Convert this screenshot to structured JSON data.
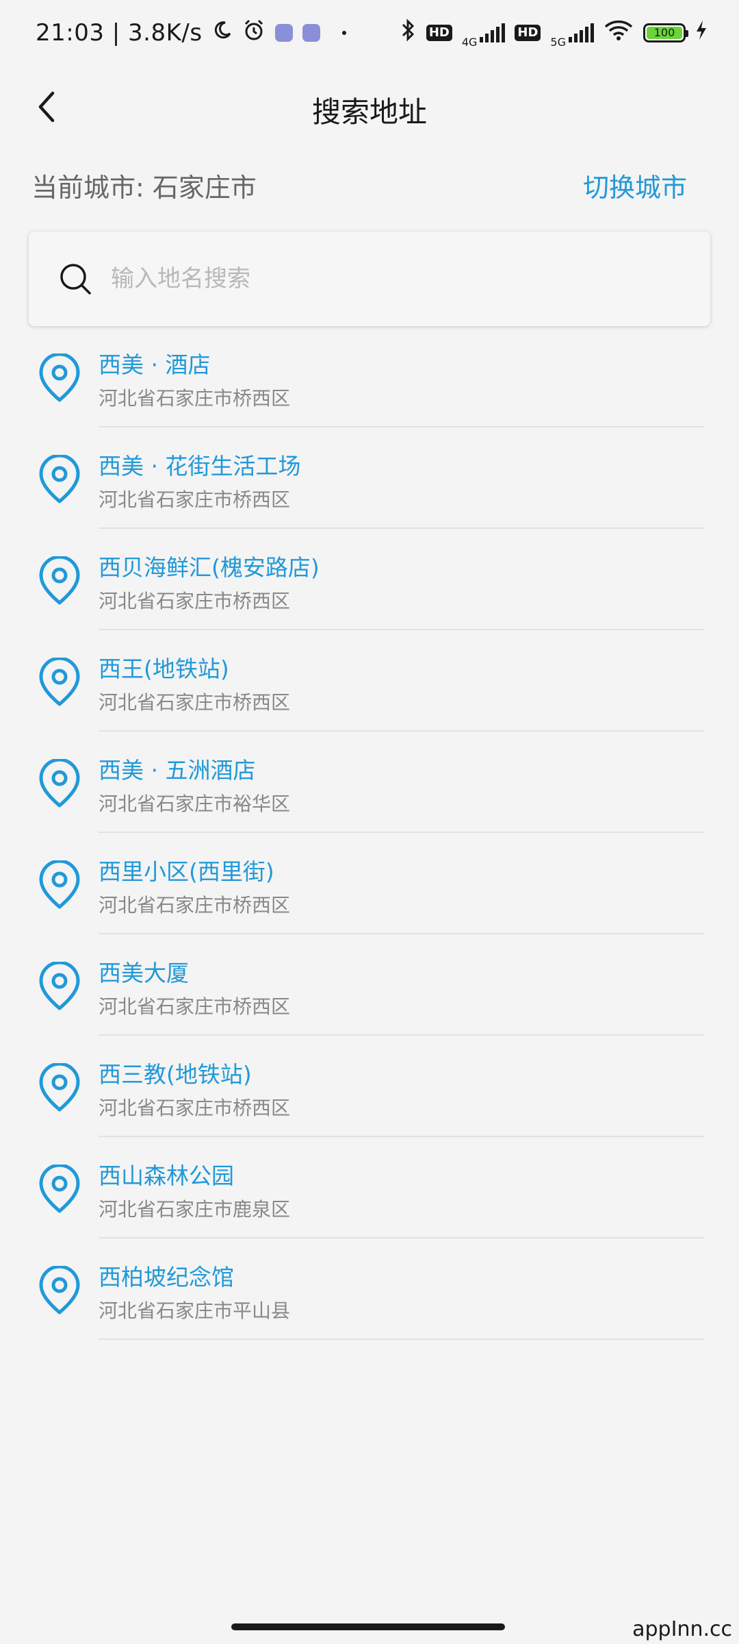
{
  "status_bar": {
    "time": "21:03 | 3.8K/s",
    "net_4g": "4G",
    "net_5g": "5G",
    "hd": "HD",
    "battery": "100"
  },
  "header": {
    "title": "搜索地址"
  },
  "city": {
    "current_label": "当前城市: 石家庄市",
    "switch_label": "切换城市"
  },
  "search": {
    "placeholder": "输入地名搜索",
    "value": ""
  },
  "results": [
    {
      "name": "西美 · 酒店",
      "address": "河北省石家庄市桥西区"
    },
    {
      "name": "西美 · 花街生活工场",
      "address": "河北省石家庄市桥西区"
    },
    {
      "name": "西贝海鲜汇(槐安路店)",
      "address": "河北省石家庄市桥西区"
    },
    {
      "name": "西王(地铁站)",
      "address": "河北省石家庄市桥西区"
    },
    {
      "name": "西美 · 五洲酒店",
      "address": "河北省石家庄市裕华区"
    },
    {
      "name": "西里小区(西里街)",
      "address": "河北省石家庄市桥西区"
    },
    {
      "name": "西美大厦",
      "address": "河北省石家庄市桥西区"
    },
    {
      "name": "西三教(地铁站)",
      "address": "河北省石家庄市桥西区"
    },
    {
      "name": "西山森林公园",
      "address": "河北省石家庄市鹿泉区"
    },
    {
      "name": "西柏坡纪念馆",
      "address": "河北省石家庄市平山县"
    }
  ],
  "watermark": "appInn.cc",
  "colors": {
    "accent": "#2199d8",
    "secondary_text": "#888888",
    "background": "#f4f4f4"
  },
  "icons": {
    "back": "back-arrow-icon",
    "search": "search-icon",
    "result": "location-pin-icon"
  }
}
